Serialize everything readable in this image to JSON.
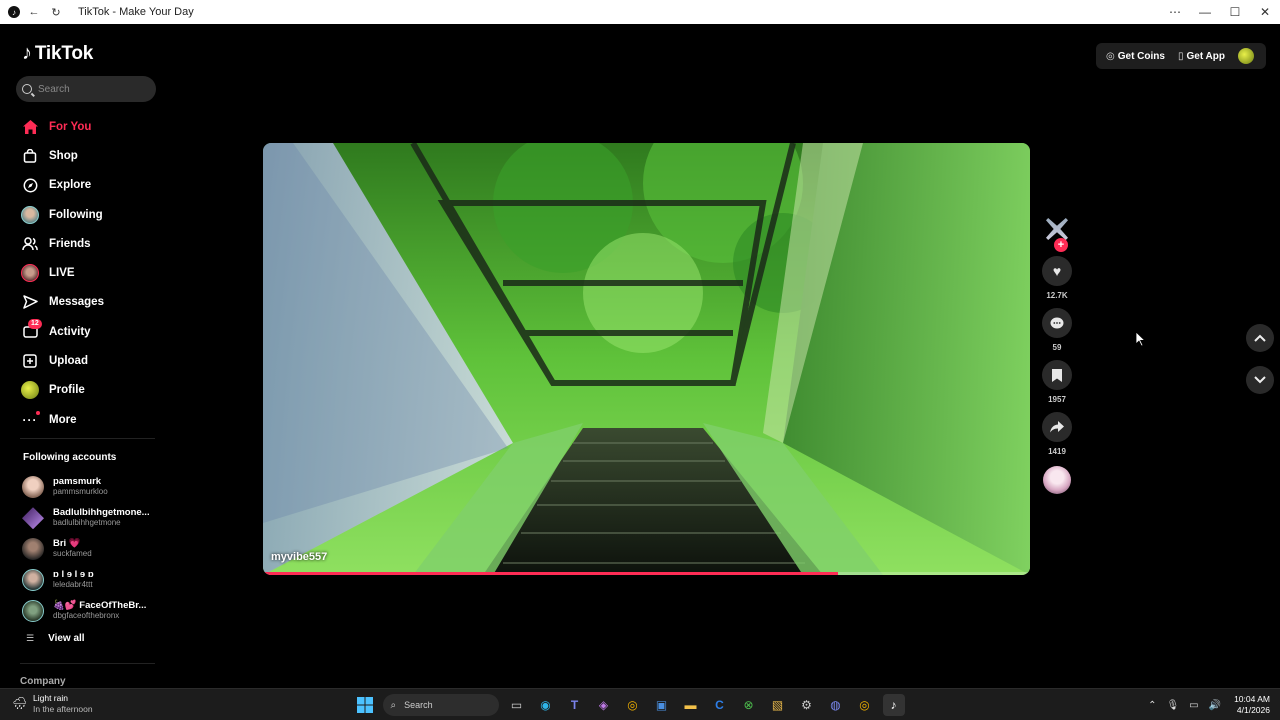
{
  "window": {
    "title": "TikTok - Make Your Day",
    "controls": [
      "⋯",
      "—",
      "☐",
      "✕"
    ]
  },
  "sidebar": {
    "logo": "TikTok",
    "search_placeholder": "Search",
    "nav": [
      {
        "label": "For You",
        "icon": "home-icon",
        "active": true
      },
      {
        "label": "Shop",
        "icon": "shop-icon"
      },
      {
        "label": "Explore",
        "icon": "compass-icon"
      },
      {
        "label": "Following",
        "icon": "following-avatar-icon"
      },
      {
        "label": "Friends",
        "icon": "friends-icon"
      },
      {
        "label": "LIVE",
        "icon": "live-avatar-icon"
      },
      {
        "label": "Messages",
        "icon": "messages-icon"
      },
      {
        "label": "Activity",
        "icon": "activity-icon",
        "badge": "12"
      },
      {
        "label": "Upload",
        "icon": "upload-icon"
      },
      {
        "label": "Profile",
        "icon": "profile-avatar-icon"
      },
      {
        "label": "More",
        "icon": "more-icon"
      }
    ],
    "following_title": "Following accounts",
    "following": [
      {
        "name": "pamsmurk",
        "username": "pammsmurkloo"
      },
      {
        "name": "Badlulbihhgetmone...",
        "username": "badlulbihhgetmone"
      },
      {
        "name": "Bri 💗",
        "username": "suckfamed"
      },
      {
        "name": "ɒ l ɘ l ɘ ɒ",
        "username": "leledabr4ttt"
      },
      {
        "name": "🍇💕 FaceOfTheBr...",
        "username": "dbgfaceofthebronx"
      }
    ],
    "view_all": "View all",
    "company": "Company"
  },
  "topbar": {
    "get_coins": "Get Coins",
    "get_app": "Get App"
  },
  "video": {
    "author": "myvibe557",
    "progress": 0.75
  },
  "actions": {
    "likes": "12.7K",
    "comments": "59",
    "saves": "1957",
    "shares": "1419"
  },
  "taskbar": {
    "weather_title": "Light rain",
    "weather_sub": "In the afternoon",
    "search": "Search",
    "time": "10:04 AM",
    "date": "4/1/2026"
  }
}
